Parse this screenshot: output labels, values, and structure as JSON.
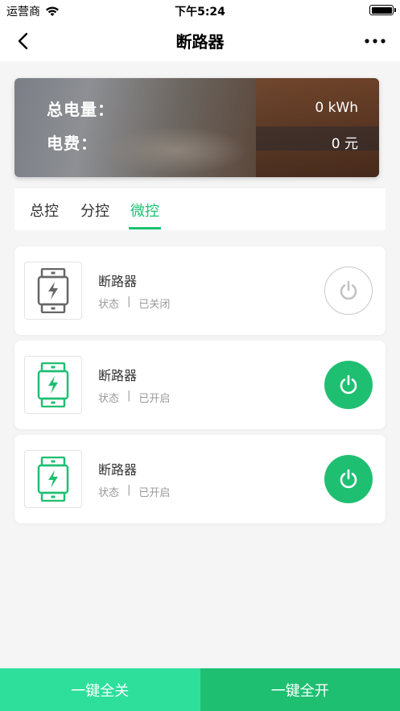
{
  "status_bar": {
    "carrier": "运营商",
    "time": "下午5:24"
  },
  "nav": {
    "title": "断路器",
    "back_icon": "chevron-left-icon",
    "more_icon": "more-dots-icon"
  },
  "summary": {
    "total_energy_label": "总电量：",
    "total_energy_value": "0 kWh",
    "fee_label": "电费：",
    "fee_value": "0 元"
  },
  "tabs": [
    {
      "label": "总控",
      "active": false
    },
    {
      "label": "分控",
      "active": false
    },
    {
      "label": "微控",
      "active": true
    }
  ],
  "devices": [
    {
      "name": "断路器",
      "status_label": "状态",
      "separator": "|",
      "status_value": "已关闭",
      "on": false,
      "icon": "breaker-icon"
    },
    {
      "name": "断路器",
      "status_label": "状态",
      "separator": "|",
      "status_value": "已开启",
      "on": true,
      "icon": "breaker-icon"
    },
    {
      "name": "断路器",
      "status_label": "状态",
      "separator": "|",
      "status_value": "已开启",
      "on": true,
      "icon": "breaker-icon"
    }
  ],
  "bottom": {
    "all_off_label": "一键全关",
    "all_on_label": "一键全开"
  },
  "colors": {
    "accent": "#1fbf72",
    "accent_light": "#2ddf9b",
    "icon_off": "#666666"
  }
}
